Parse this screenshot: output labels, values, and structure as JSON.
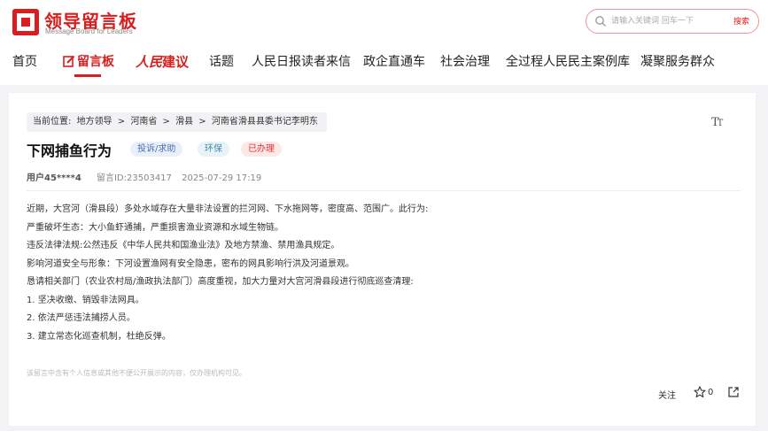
{
  "header": {
    "logo_title": "领导留言板",
    "logo_subtitle": "Message Board for Leaders",
    "search_placeholder": "请输入关键词 回车一下",
    "search_button": "搜索"
  },
  "nav": {
    "items": [
      {
        "label": "首页"
      },
      {
        "label": "留言板",
        "active": true
      },
      {
        "label_a": "人民",
        "label_b": "建议"
      },
      {
        "label": "话题"
      },
      {
        "label": "人民日报读者来信"
      },
      {
        "label": "政企直通车"
      },
      {
        "label": "社会治理"
      },
      {
        "label": "全过程人民民主案例库"
      },
      {
        "label": "凝聚服务群众"
      }
    ]
  },
  "breadcrumb": {
    "prefix": "当前位置:",
    "items": [
      "地方领导",
      "河南省",
      "滑县",
      "河南省滑县县委书记李明东"
    ],
    "separator": ">"
  },
  "message": {
    "title": "下网捕鱼行为",
    "tags": [
      "投诉/求助",
      "环保",
      "已办理"
    ],
    "user": "用户45****4",
    "message_id": "留言ID:23503417",
    "date": "2025-07-29 17:19",
    "content": [
      "近期，大宫河（滑县段）多处水域存在大量非法设置的拦河网、下水拖网等，密度高、范围广。此行为:",
      "严重破坏生态：大小鱼虾通捕，严重损害渔业资源和水域生物链。",
      "违反法律法规:公然违反《中华人民共和国渔业法》及地方禁渔、禁用渔具规定。",
      "影响河道安全与形象：下河设置渔网有安全隐患，密布的网具影响行洪及河道景观。",
      "恳请相关部门（农业农村局/渔政执法部门）高度重视，加大力量对大宫河滑县段进行彻底巡查清理:",
      "1. 坚决收缴、销毁非法网具。",
      "2. 依法严惩违法捕捞人员。",
      "3. 建立常态化巡查机制，杜绝反弹。"
    ],
    "notice": "该留言中含有个人信息或其他不便公开展示的内容，仅办理机构可见。"
  },
  "actions": {
    "follow_label": "关注",
    "star_count": "0"
  },
  "icons": {
    "font_size": "font-size-icon",
    "star": "star-icon",
    "share": "share-icon",
    "search": "search-icon",
    "edit": "edit-icon"
  },
  "colors": {
    "brand": "#d81e1e",
    "tag_blue": "#4a6fb0",
    "tag_teal": "#3e8aa4",
    "tag_red": "#dd3333"
  }
}
